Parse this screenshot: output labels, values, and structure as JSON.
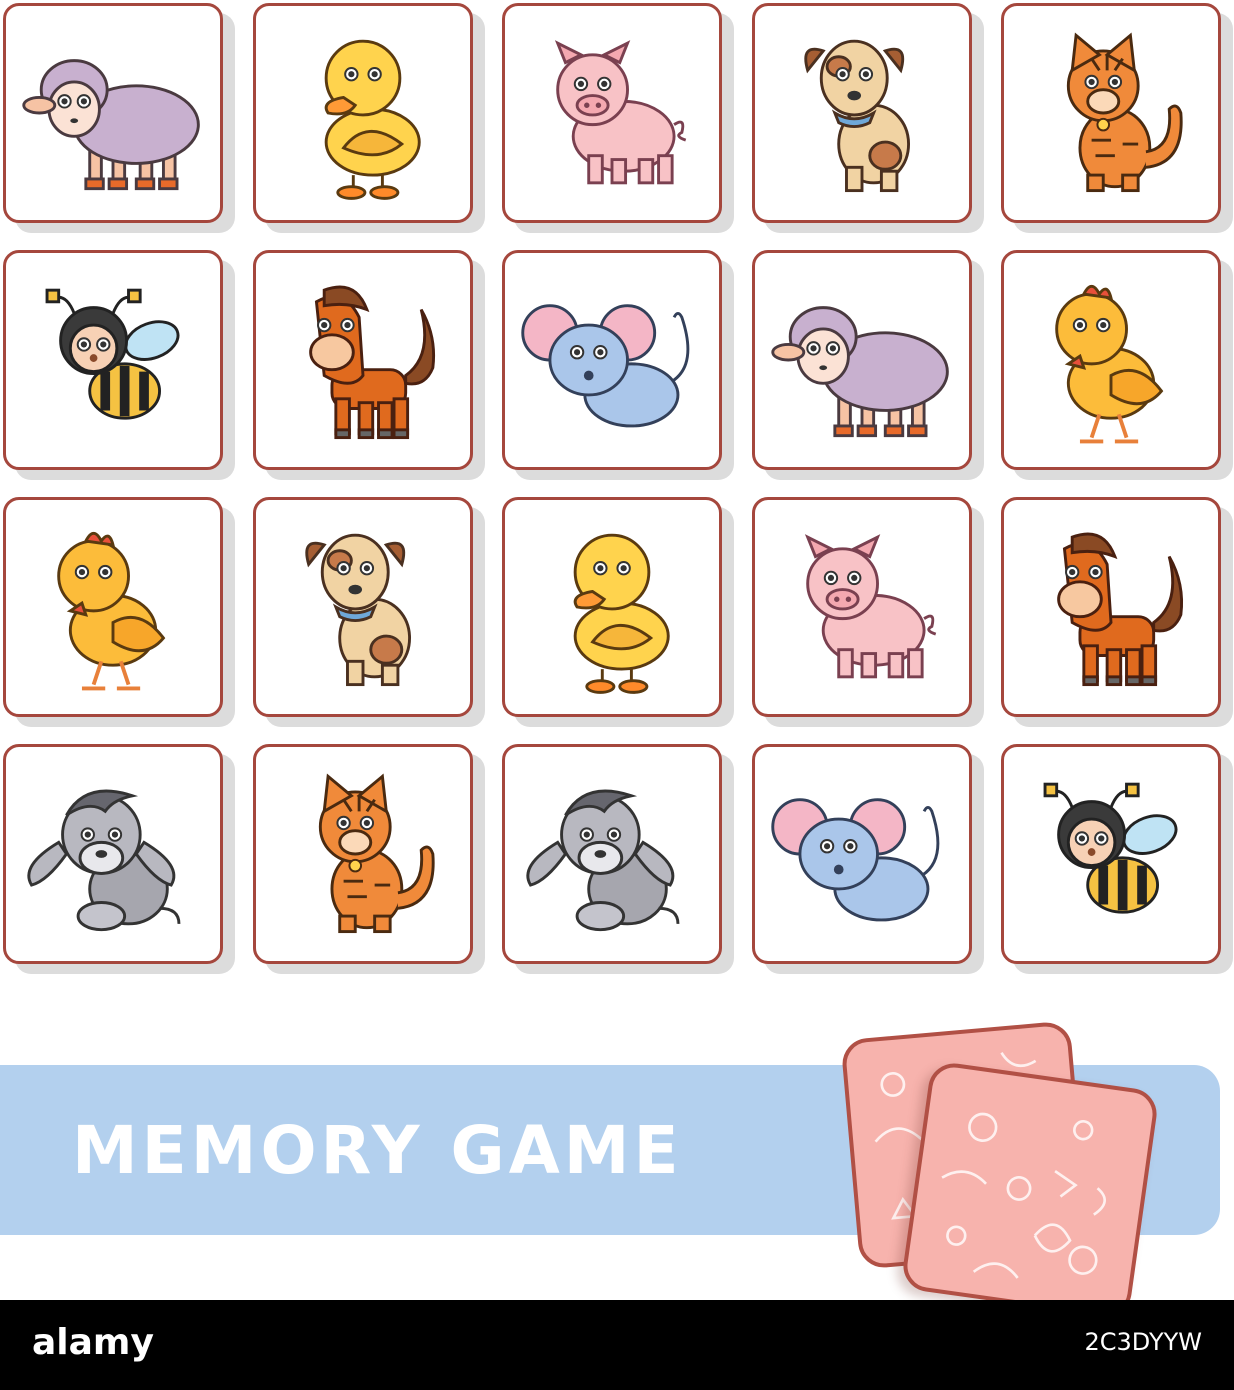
{
  "title": "MEMORY GAME",
  "cards": [
    [
      "sheep",
      "duck",
      "pig",
      "dog",
      "cat"
    ],
    [
      "bee",
      "horse",
      "mouse",
      "sheep",
      "chick"
    ],
    [
      "chick",
      "dog",
      "duck",
      "pig",
      "horse"
    ],
    [
      "donkey",
      "cat",
      "donkey",
      "mouse",
      "bee"
    ]
  ],
  "colors": {
    "card_border": "#a5473d",
    "banner": "#b3d0ee",
    "card_back": "#f7b3ad"
  },
  "watermark": {
    "logo": "alamy",
    "image_code": "2C3DYYW"
  }
}
